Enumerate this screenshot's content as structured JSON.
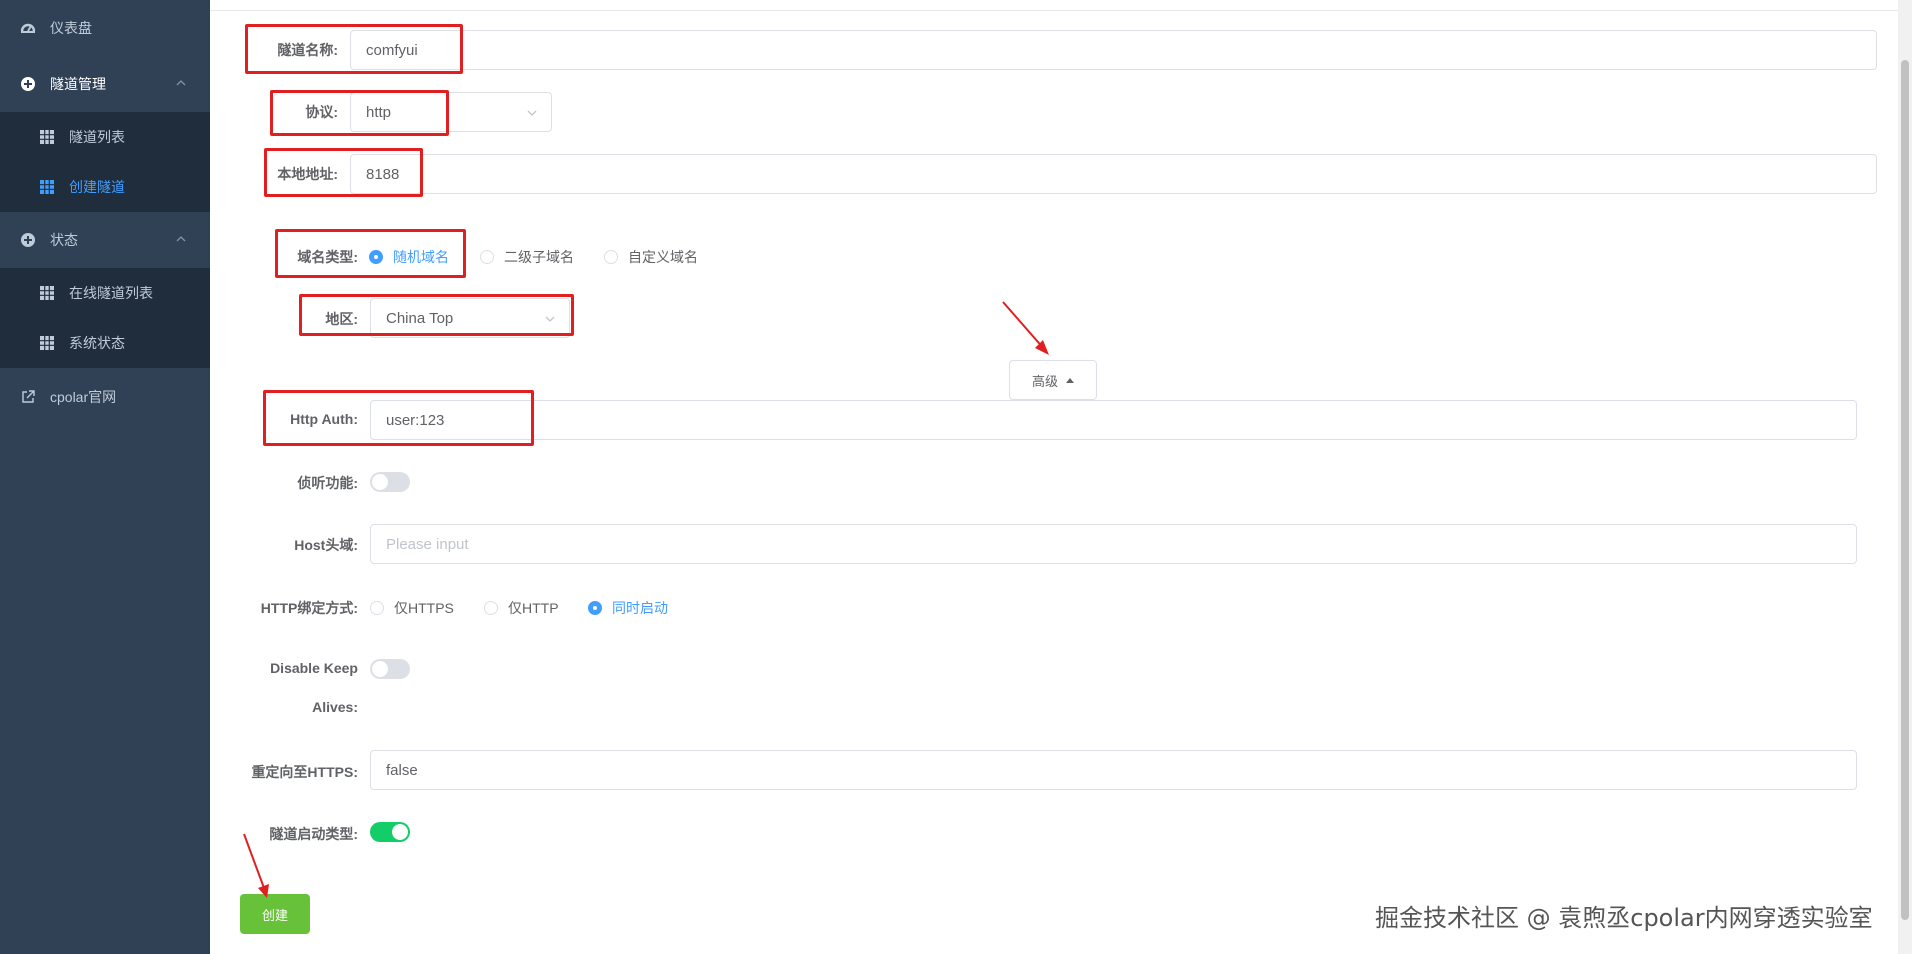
{
  "sidebar": {
    "dashboard": "仪表盘",
    "tunnel_mgmt": "隧道管理",
    "tunnel_list": "隧道列表",
    "create_tunnel": "创建隧道",
    "status": "状态",
    "online_list": "在线隧道列表",
    "system_status": "系统状态",
    "website": "cpolar官网"
  },
  "form": {
    "name_label": "隧道名称:",
    "name_value": "comfyui",
    "protocol_label": "协议:",
    "protocol_value": "http",
    "local_label": "本地地址:",
    "local_value": "8188",
    "domain_type_label": "域名类型:",
    "domain_options": [
      "随机域名",
      "二级子域名",
      "自定义域名"
    ],
    "region_label": "地区:",
    "region_value": "China Top",
    "advanced_label": "高级",
    "auth_label": "Http Auth:",
    "auth_value": "user:123",
    "listen_label": "侦听功能:",
    "host_label": "Host头域:",
    "host_placeholder": "Please input",
    "bind_label": "HTTP绑定方式:",
    "bind_options": [
      "仅HTTPS",
      "仅HTTP",
      "同时启动"
    ],
    "keepalive_label_1": "Disable Keep",
    "keepalive_label_2": "Alives:",
    "redirect_label": "重定向至HTTPS:",
    "redirect_value": "false",
    "autostart_label": "隧道启动类型:",
    "create_label": "创建"
  },
  "watermark": "掘金技术社区 @ 袁煦丞cpolar内网穿透实验室",
  "colors": {
    "sidebar_bg": "#304156",
    "submenu_bg": "#1f2d3d",
    "active": "#409eff",
    "create_button": "#67c23a",
    "switch_on": "#13ce66",
    "annotation": "#e02020"
  }
}
